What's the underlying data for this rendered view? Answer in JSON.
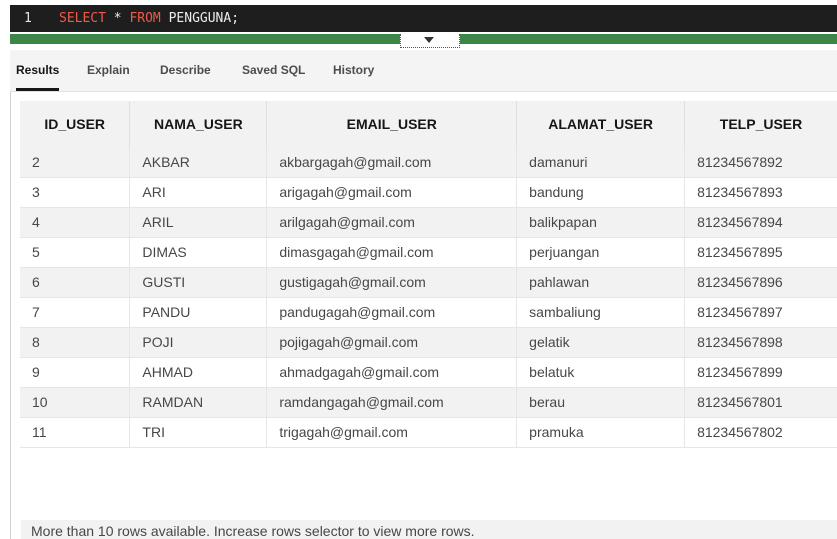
{
  "editor": {
    "line_number": "1",
    "kw_select": "SELECT",
    "star": " * ",
    "kw_from": "FROM",
    "table_name": " PENGGUNA;"
  },
  "tabs": [
    {
      "label": "Results",
      "active": true
    },
    {
      "label": "Explain",
      "active": false
    },
    {
      "label": "Describe",
      "active": false
    },
    {
      "label": "Saved SQL",
      "active": false
    },
    {
      "label": "History",
      "active": false
    }
  ],
  "results": {
    "columns": [
      "ID_USER",
      "NAMA_USER",
      "EMAIL_USER",
      "ALAMAT_USER",
      "TELP_USER"
    ],
    "rows": [
      [
        "2",
        "AKBAR",
        "akbargagah@gmail.com",
        "damanuri",
        "81234567892"
      ],
      [
        "3",
        "ARI",
        "arigagah@gmail.com",
        "bandung",
        "81234567893"
      ],
      [
        "4",
        "ARIL",
        "arilgagah@gmail.com",
        "balikpapan",
        "81234567894"
      ],
      [
        "5",
        "DIMAS",
        "dimasgagah@gmail.com",
        "perjuangan",
        "81234567895"
      ],
      [
        "6",
        "GUSTI",
        "gustigagah@gmail.com",
        "pahlawan",
        "81234567896"
      ],
      [
        "7",
        "PANDU",
        "pandugagah@gmail.com",
        "sambaliung",
        "81234567897"
      ],
      [
        "8",
        "POJI",
        "pojigagah@gmail.com",
        "gelatik",
        "81234567898"
      ],
      [
        "9",
        "AHMAD",
        "ahmadgagah@gmail.com",
        "belatuk",
        "81234567899"
      ],
      [
        "10",
        "RAMDAN",
        "ramdangagah@gmail.com",
        "berau",
        "81234567801"
      ],
      [
        "11",
        "TRI",
        "trigagah@gmail.com",
        "pramuka",
        "81234567802"
      ]
    ],
    "footer": "More than 10 rows available. Increase rows selector to view more rows."
  }
}
